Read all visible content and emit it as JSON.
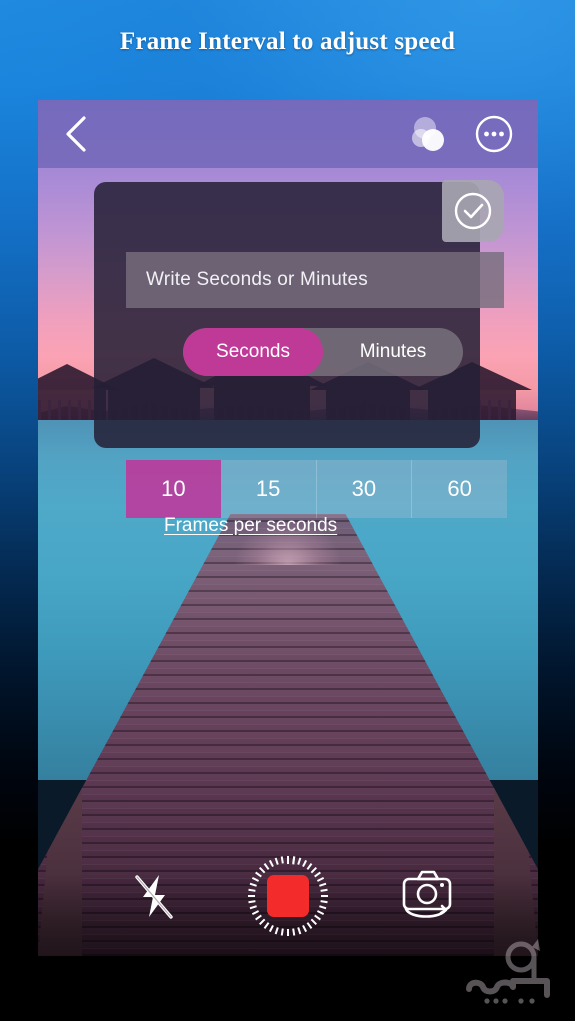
{
  "promo": {
    "title": "Frame Interval to adjust speed",
    "background_top_color": "#1f8ae0",
    "background_bottom_color": "#000000"
  },
  "app": {
    "topbar": {
      "back_icon": "chevron-left-icon",
      "filter_icon": "overlapping-circles-icon",
      "more_icon": "more-options-icon"
    },
    "dialog": {
      "confirm_icon": "check-circle-icon",
      "duration_input": {
        "value": "",
        "placeholder": "Write Seconds or Minutes"
      },
      "unit_toggle": {
        "options": [
          {
            "label": "Seconds",
            "active": true
          },
          {
            "label": "Minutes",
            "active": false
          }
        ],
        "active_color": "#bf3a97"
      },
      "fps": {
        "label": "Frames per seconds",
        "options": [
          {
            "value": "10",
            "active": true
          },
          {
            "value": "15",
            "active": false
          },
          {
            "value": "30",
            "active": false
          },
          {
            "value": "60",
            "active": false
          }
        ],
        "active_color": "#c32a96"
      }
    },
    "bottom_controls": {
      "flash_icon": "flash-off-icon",
      "record_icon": "stop-record-icon",
      "record_color": "#f42b2b",
      "switch_camera_icon": "switch-camera-icon"
    },
    "watermark": {
      "icon": "sarshar-logo-watermark"
    }
  }
}
